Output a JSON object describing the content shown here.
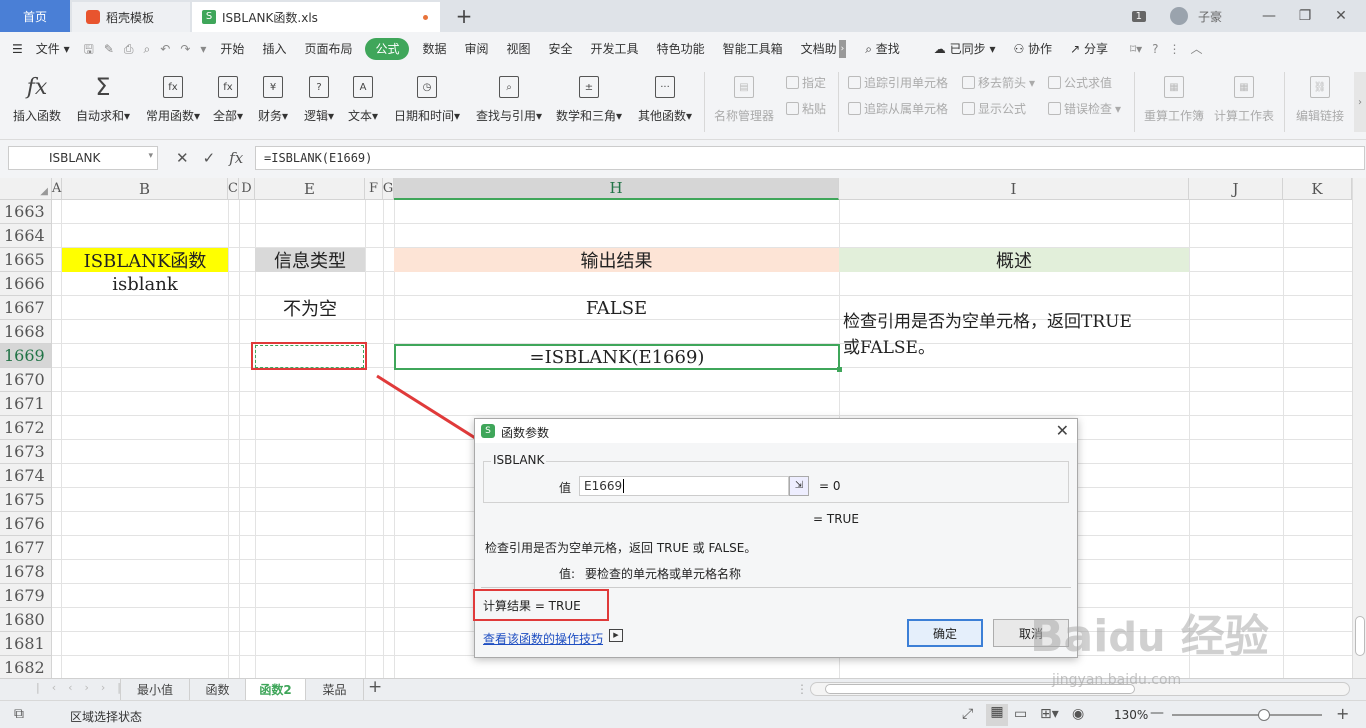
{
  "titlebar": {
    "tab_home": "首页",
    "tab_template": "稻壳模板",
    "tab_file": "ISBLANK函数.xls",
    "badge": "1",
    "user": "子豪"
  },
  "menu": {
    "file": "文件",
    "items": [
      "开始",
      "插入",
      "页面布局",
      "公式",
      "数据",
      "审阅",
      "视图",
      "安全",
      "开发工具",
      "特色功能",
      "智能工具箱",
      "文档助"
    ],
    "active": "公式",
    "search": "查找",
    "sync": "已同步",
    "collab": "协作",
    "share": "分享"
  },
  "ribbon": {
    "insert_func": "插入函数",
    "autosum": "自动求和",
    "common": "常用函数",
    "all": "全部",
    "finance": "财务",
    "logic": "逻辑",
    "text": "文本",
    "datetime": "日期和时间",
    "lookup": "查找与引用",
    "math": "数学和三角",
    "other": "其他函数",
    "name_mgr": "名称管理器",
    "define": "指定",
    "paste": "粘贴",
    "trace_prec": "追踪引用单元格",
    "trace_dep": "追踪从属单元格",
    "remove_arrows": "移去箭头",
    "show_formula": "显示公式",
    "eval": "公式求值",
    "error_check": "错误检查",
    "recalc": "重算工作簿",
    "calc_sheet": "计算工作表",
    "edit_links": "编辑链接"
  },
  "formula_bar": {
    "name_box": "ISBLANK",
    "formula": "=ISBLANK(E1669)"
  },
  "sheet": {
    "columns": [
      "A",
      "B",
      "C",
      "D",
      "E",
      "F",
      "G",
      "H",
      "I",
      "J",
      "K"
    ],
    "rows": [
      "1663",
      "1664",
      "1665",
      "1666",
      "1667",
      "1668",
      "1669",
      "1670",
      "1671",
      "1672",
      "1673",
      "1674",
      "1675",
      "1676",
      "1677",
      "1678",
      "1679",
      "1680",
      "1681",
      "1682"
    ],
    "b1665": "ISBLANK函数",
    "b1666": "isblank",
    "e1665": "信息类型",
    "e1667": "不为空",
    "h1665": "输出结果",
    "h1667": "FALSE",
    "h1669": "=ISBLANK(E1669)",
    "i1665": "概述",
    "i1667_line1": "检查引用是否为空单元格，返回TRUE",
    "i1667_line2": "或FALSE。"
  },
  "dialog": {
    "title": "函数参数",
    "group": "ISBLANK",
    "arg_label": "值",
    "arg_value": "E1669",
    "arg_result": "= 0",
    "func_result": "= TRUE",
    "description": "检查引用是否为空单元格，返回 TRUE 或 FALSE。",
    "arg_desc_label": "值:",
    "arg_desc": "要检查的单元格或单元格名称",
    "calc_result": "计算结果 =  TRUE",
    "help_link": "查看该函数的操作技巧",
    "ok": "确定",
    "cancel": "取消"
  },
  "sheet_tabs": [
    "最小值",
    "函数",
    "函数2",
    "菜品"
  ],
  "active_sheet": "函数2",
  "status": {
    "mode": "区域选择状态",
    "zoom": "130%"
  },
  "colors": {
    "accent": "#3fa65a",
    "home_tab": "#4a7fd6",
    "highlight_red": "#e03a3a",
    "yellow": "#ffff00",
    "gray_header": "#d9d9d9",
    "peach": "#fde4d6",
    "light_green": "#e2efda"
  }
}
